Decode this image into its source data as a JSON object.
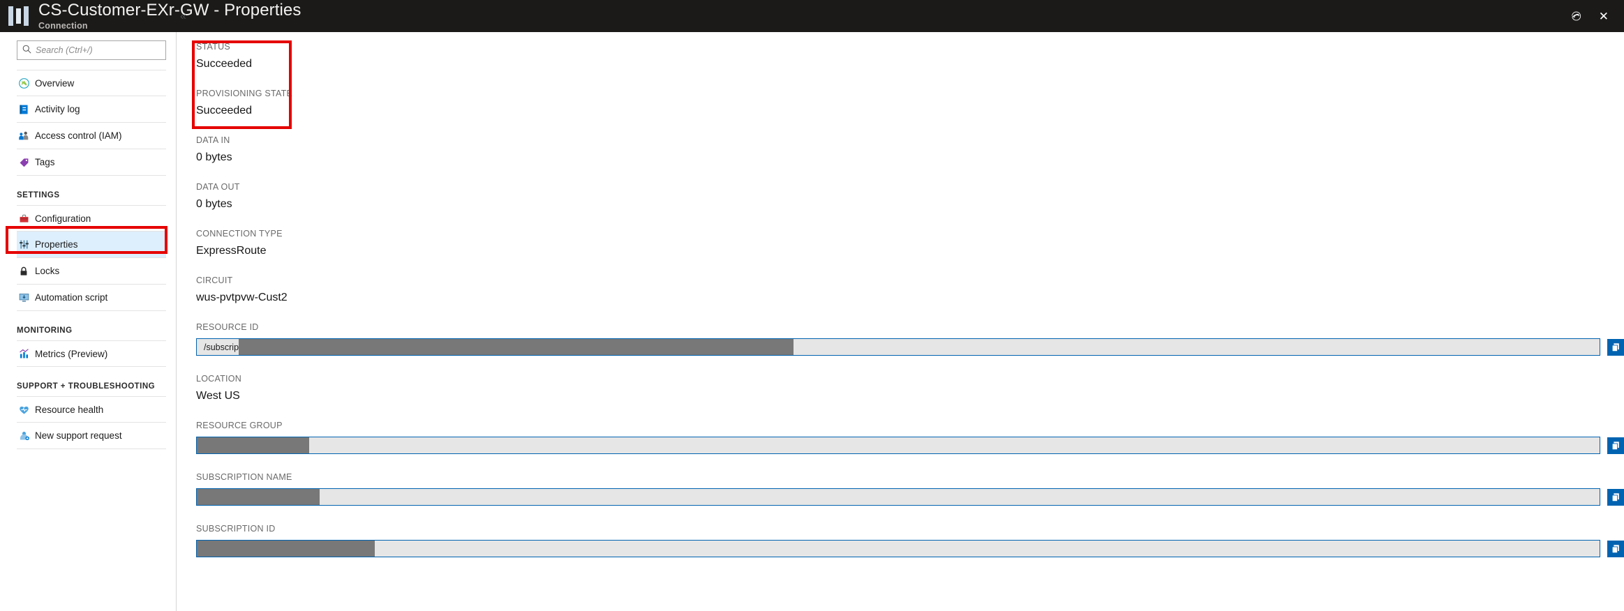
{
  "titlebar": {
    "title": "CS-Customer-EXr-GW - Properties",
    "subtitle": "Connection",
    "pin_label": "✆",
    "close_label": "✕",
    "pin_icon": "pin-icon",
    "close_icon": "close-icon"
  },
  "sidebar": {
    "search": {
      "placeholder": "Search (Ctrl+/)",
      "value": "",
      "icon": "search-icon"
    },
    "collapse_label": "«",
    "items": [
      {
        "label": "Overview",
        "icon": "overview-icon",
        "selected": false
      },
      {
        "label": "Activity log",
        "icon": "activity-log-icon",
        "selected": false
      },
      {
        "label": "Access control (IAM)",
        "icon": "access-control-icon",
        "selected": false
      },
      {
        "label": "Tags",
        "icon": "tag-icon",
        "selected": false
      }
    ],
    "groups": [
      {
        "title": "SETTINGS",
        "items": [
          {
            "label": "Configuration",
            "icon": "configuration-icon",
            "selected": false
          },
          {
            "label": "Properties",
            "icon": "properties-icon",
            "selected": true
          },
          {
            "label": "Locks",
            "icon": "lock-icon",
            "selected": false
          },
          {
            "label": "Automation script",
            "icon": "automation-script-icon",
            "selected": false
          }
        ]
      },
      {
        "title": "MONITORING",
        "items": [
          {
            "label": "Metrics (Preview)",
            "icon": "metrics-icon",
            "selected": false
          }
        ]
      },
      {
        "title": "SUPPORT + TROUBLESHOOTING",
        "items": [
          {
            "label": "Resource health",
            "icon": "resource-health-icon",
            "selected": false
          },
          {
            "label": "New support request",
            "icon": "support-request-icon",
            "selected": false
          }
        ]
      }
    ]
  },
  "main": {
    "status": {
      "label": "STATUS",
      "value": "Succeeded"
    },
    "provisioning_state": {
      "label": "PROVISIONING STATE",
      "value": "Succeeded"
    },
    "data_in": {
      "label": "DATA IN",
      "value": "0 bytes"
    },
    "data_out": {
      "label": "DATA OUT",
      "value": "0 bytes"
    },
    "connection_type": {
      "label": "CONNECTION TYPE",
      "value": "ExpressRoute"
    },
    "circuit": {
      "label": "CIRCUIT",
      "value": "wus-pvtpvw-Cust2"
    },
    "resource_id": {
      "label": "RESOURCE ID",
      "value": "/subscriptions",
      "redacted": true,
      "copy_icon": "copy-icon"
    },
    "location": {
      "label": "LOCATION",
      "value": "West US"
    },
    "resource_group": {
      "label": "RESOURCE GROUP",
      "value": "",
      "redacted": true,
      "copy_icon": "copy-icon"
    },
    "subscription_name": {
      "label": "SUBSCRIPTION NAME",
      "value": "",
      "redacted": true,
      "copy_icon": "copy-icon"
    },
    "subscription_id": {
      "label": "SUBSCRIPTION ID",
      "value": "",
      "redacted": true,
      "copy_icon": "copy-icon"
    }
  },
  "colors": {
    "titlebar_bg": "#1b1a19",
    "accent_blue": "#0063b1",
    "highlight_red": "#e60000",
    "selected_row": "#ddeefc",
    "redaction_gray": "#787878"
  }
}
